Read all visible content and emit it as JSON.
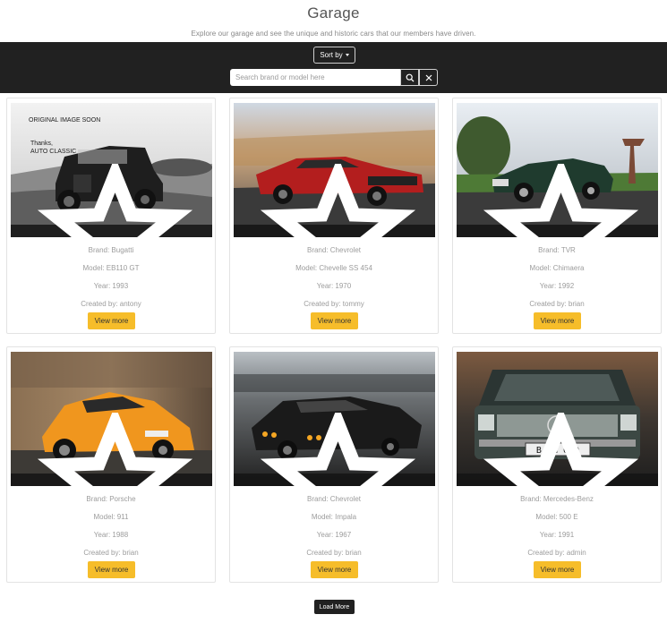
{
  "header": {
    "title": "Garage",
    "subtitle": "Explore our garage and see the unique and historic cars that our members have driven."
  },
  "toolbar": {
    "sort_label": "Sort by",
    "search_placeholder": "Search brand or model here",
    "search_value": ""
  },
  "cars": [
    {
      "stars": "0",
      "brand": "Brand: Bugatti",
      "model": "Model: EB110 GT",
      "year": "Year: 1993",
      "created_by": "Created by: antony",
      "view_label": "View more",
      "image_text_1": "ORIGINAL IMAGE SOON",
      "image_text_2": "Thanks,",
      "image_text_3": "AUTO CLASSIC"
    },
    {
      "stars": "1",
      "brand": "Brand: Chevrolet",
      "model": "Model: Chevelle SS 454",
      "year": "Year: 1970",
      "created_by": "Created by: tommy",
      "view_label": "View more"
    },
    {
      "stars": "1",
      "brand": "Brand: TVR",
      "model": "Model: Chimaera",
      "year": "Year: 1992",
      "created_by": "Created by: brian",
      "view_label": "View more"
    },
    {
      "stars": "0",
      "brand": "Brand: Porsche",
      "model": "Model: 911",
      "year": "Year: 1988",
      "created_by": "Created by: brian",
      "view_label": "View more"
    },
    {
      "stars": "0",
      "brand": "Brand: Chevrolet",
      "model": "Model: Impala",
      "year": "Year: 1967",
      "created_by": "Created by: brian",
      "view_label": "View more"
    },
    {
      "stars": "1",
      "brand": "Brand: Mercedes-Benz",
      "model": "Model: 500 E",
      "year": "Year: 1991",
      "created_by": "Created by: admin",
      "view_label": "View more",
      "plate_text": "B NN 660"
    }
  ],
  "load_more_label": "Load More",
  "colors": {
    "toolbar_bg": "#212121",
    "view_button": "#f6bd2a"
  }
}
